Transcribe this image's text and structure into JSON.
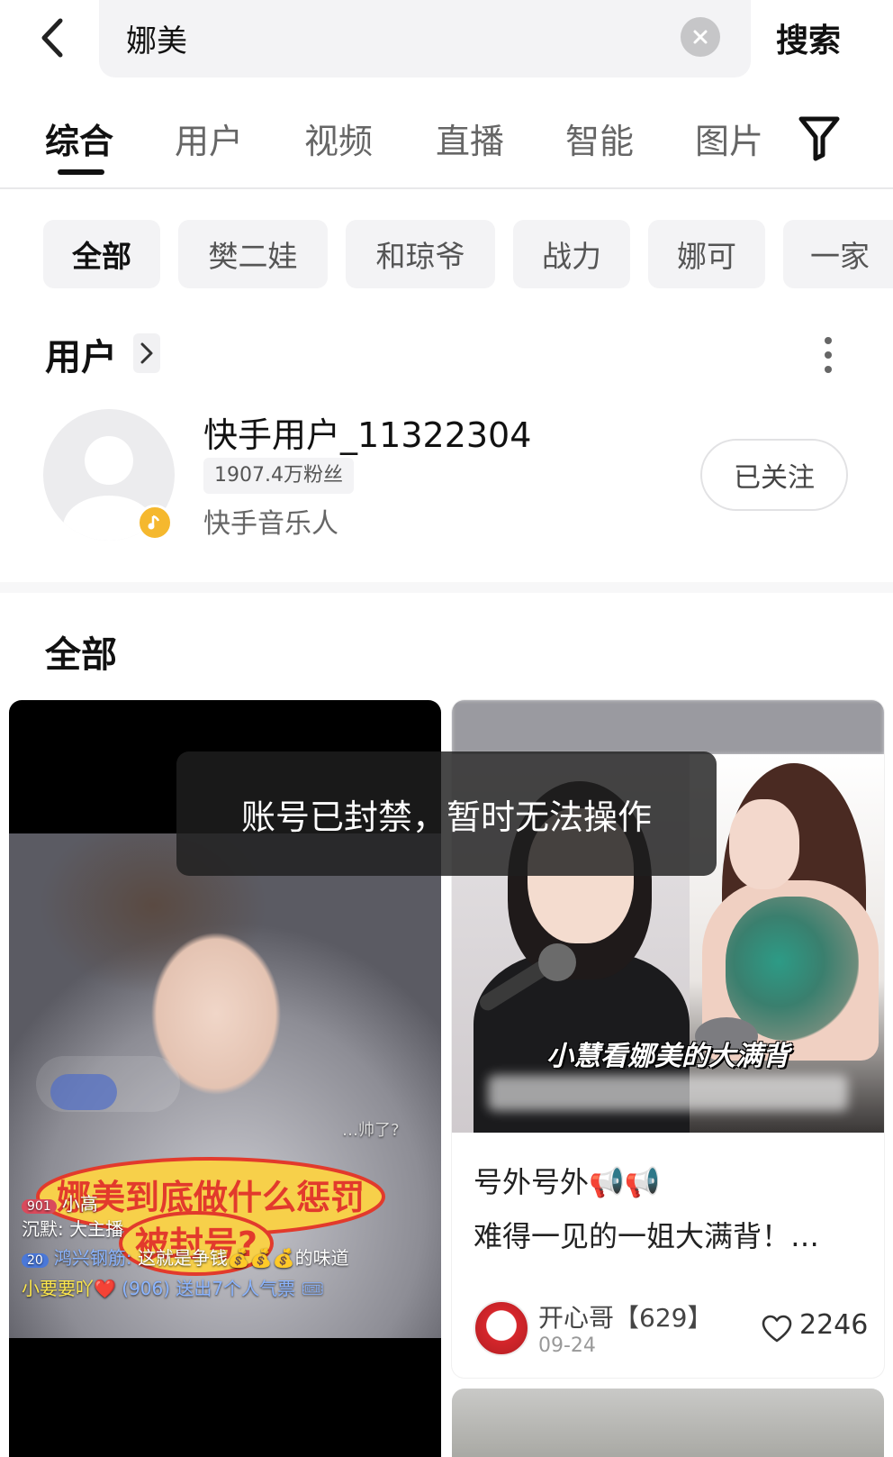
{
  "search": {
    "query": "娜美",
    "button_label": "搜索"
  },
  "tabs": [
    {
      "label": "综合",
      "active": true
    },
    {
      "label": "用户"
    },
    {
      "label": "视频"
    },
    {
      "label": "直播"
    },
    {
      "label": "智能"
    },
    {
      "label": "图片"
    }
  ],
  "chips": [
    {
      "label": "全部",
      "active": true
    },
    {
      "label": "樊二娃"
    },
    {
      "label": "和琼爷"
    },
    {
      "label": "战力"
    },
    {
      "label": "娜可"
    },
    {
      "label": "一家"
    }
  ],
  "users_section": {
    "title": "用户",
    "user": {
      "name": "快手用户_11322304",
      "fans": "1907.4万粉丝",
      "role": "快手音乐人",
      "follow_label": "已关注"
    }
  },
  "all_section": {
    "title": "全部"
  },
  "left_card": {
    "stamp_line1": "娜美到底做什么惩罚",
    "stamp_line2": "被封号?",
    "comments": [
      {
        "text": "…帅了?"
      },
      {
        "tag": "901",
        "text": "小高"
      },
      {
        "user": "沉默:",
        "text": "大主播"
      },
      {
        "tag": "20",
        "user": "鸿兴钢筋:",
        "text": "这就是争钱💰💰💰的味道"
      },
      {
        "user": "小要要吖❤️",
        "text": "(906) 送出7个人气票 🎟"
      }
    ]
  },
  "right_card": {
    "caption": "小慧看娜美的大满背",
    "title_line1": "号外号外📢📢",
    "title_line2": "难得一见的一姐大满背！…",
    "author": "开心哥【629】",
    "date": "09-24",
    "likes": "2246"
  },
  "toast": {
    "text": "账号已封禁，暂时无法操作"
  },
  "icons": {
    "back": "chevron-left-icon",
    "clear": "clear-icon",
    "filter": "filter-icon",
    "arrow": "chevron-right-icon",
    "more": "more-vertical-icon",
    "music": "music-note-icon",
    "heart": "heart-icon"
  },
  "colors": {
    "music_badge": "#f5b82e",
    "active_underline": "#111111",
    "stamp_red": "#e23a2c",
    "stamp_yellow": "#f7d04a"
  }
}
